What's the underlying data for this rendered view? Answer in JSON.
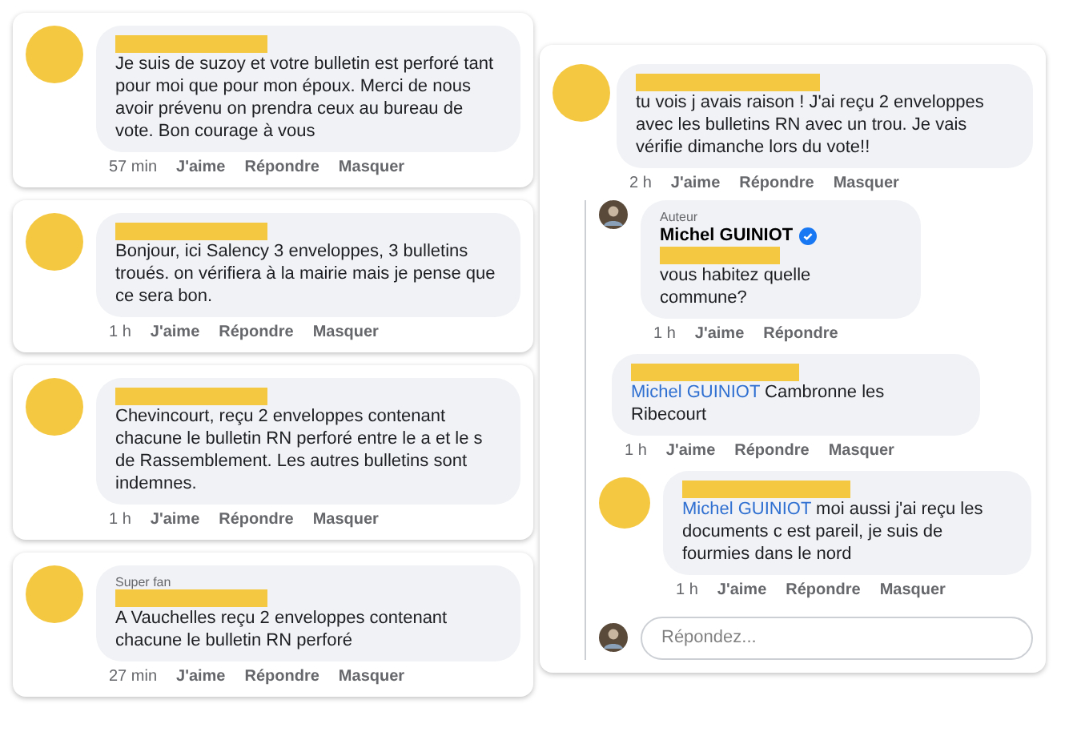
{
  "comments": [
    {
      "text": "Je suis de suzoy et votre bulletin est perforé tant pour moi que pour mon époux. Merci de nous avoir prévenu on prendra ceux au bureau de vote. Bon courage à vous",
      "time": "57 min",
      "actions": [
        "J'aime",
        "Répondre",
        "Masquer"
      ]
    },
    {
      "text": "Bonjour, ici Salency 3 enveloppes, 3 bulletins troués. on vérifiera à la mairie mais je pense que ce sera bon.",
      "time": "1 h",
      "actions": [
        "J'aime",
        "Répondre",
        "Masquer"
      ]
    },
    {
      "text": "Chevincourt,  reçu 2 enveloppes contenant chacune le bulletin RN perforé entre le a et le s de Rassemblement. Les autres bulletins sont indemnes.",
      "time": "1 h",
      "actions": [
        "J'aime",
        "Répondre",
        "Masquer"
      ]
    },
    {
      "badge": "Super fan",
      "text": "A Vauchelles reçu 2 enveloppes contenant chacune le bulletin RN perforé",
      "time": "27 min",
      "actions": [
        "J'aime",
        "Répondre",
        "Masquer"
      ]
    }
  ],
  "thread": {
    "main": {
      "text": "tu vois j avais raison ! J'ai reçu 2 enveloppes avec les bulletins RN avec un trou. Je vais vérifie dimanche lors du vote!!",
      "time": "2 h",
      "actions": [
        "J'aime",
        "Répondre",
        "Masquer"
      ]
    },
    "replies": [
      {
        "kind": "author",
        "badge": "Auteur",
        "author": "Michel GUINIOT",
        "verified": true,
        "text": "vous habitez quelle commune?",
        "time": "1 h",
        "actions": [
          "J'aime",
          "Répondre"
        ]
      },
      {
        "kind": "mention",
        "mention": "Michel GUINIOT",
        "text": "Cambronne les Ribecourt",
        "time": "1 h",
        "actions": [
          "J'aime",
          "Répondre",
          "Masquer"
        ]
      },
      {
        "kind": "mention",
        "mention": "Michel GUINIOT",
        "text": "moi aussi j'ai reçu les documents c est pareil, je suis de fourmies dans le nord",
        "time": "1 h",
        "actions": [
          "J'aime",
          "Répondre",
          "Masquer"
        ]
      }
    ],
    "reply_field": {
      "placeholder": "Répondez..."
    }
  }
}
